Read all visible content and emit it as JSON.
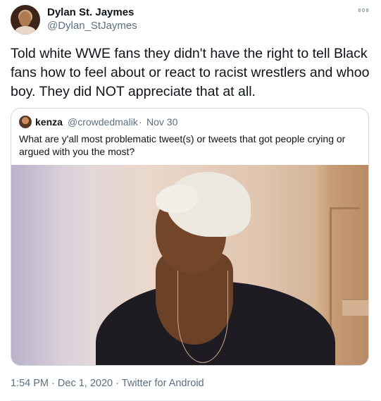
{
  "author": {
    "display_name": "Dylan St. Jaymes",
    "handle": "@Dylan_StJaymes"
  },
  "tweet": {
    "text": "Told white WWE fans they didn't have the right to tell Black fans how to feel about or react to racist wrestlers and whoo boy. They did NOT appreciate that at all."
  },
  "quoted_tweet": {
    "display_name": "kenza",
    "handle": "@crowdedmalik",
    "separator": "·",
    "date": "Nov 30",
    "text": "What are y'all most problematic tweet(s) or tweets that got people crying or argued with you the most?"
  },
  "meta": {
    "time": "1:54 PM",
    "sep1": "·",
    "date": "Dec 1, 2020",
    "sep2": "·",
    "source": "Twitter for Android"
  },
  "colors": {
    "text_primary": "#0f1419",
    "text_secondary": "#5b7083",
    "border": "#cfd9de"
  },
  "icons": {
    "more": "more-dots-icon"
  }
}
